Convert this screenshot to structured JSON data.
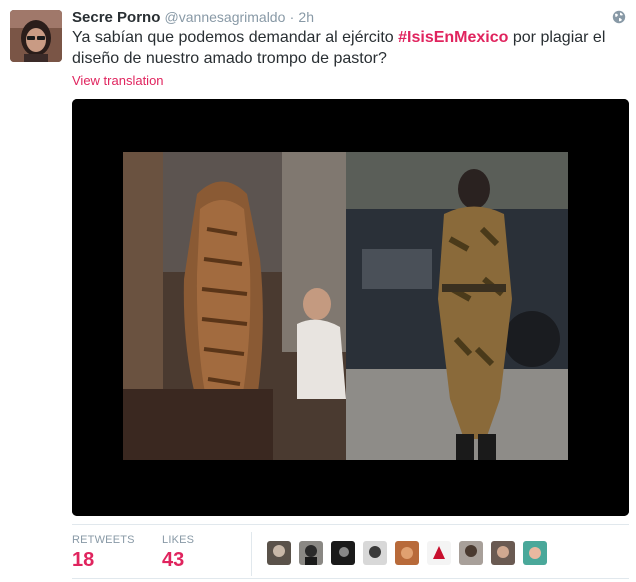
{
  "tweet": {
    "author_name": "Secre Porno",
    "handle": "@vannesagrimaldo",
    "separator": "·",
    "time": "2h",
    "text_before": "Ya sabían que podemos demandar al ejército ",
    "hashtag": "#IsisEnMexico",
    "text_after": " por plagiar el diseño de nuestro amado trompo de pastor?",
    "translate_link": "View translation"
  },
  "stats": {
    "retweets_label": "RETWEETS",
    "retweets_value": "18",
    "likes_label": "LIKES",
    "likes_value": "43"
  },
  "colors": {
    "accent": "#e0245e",
    "muted": "#8899a6",
    "text": "#292f33",
    "divider": "#e1e8ed"
  },
  "icons": {
    "globe": "globe-icon"
  }
}
